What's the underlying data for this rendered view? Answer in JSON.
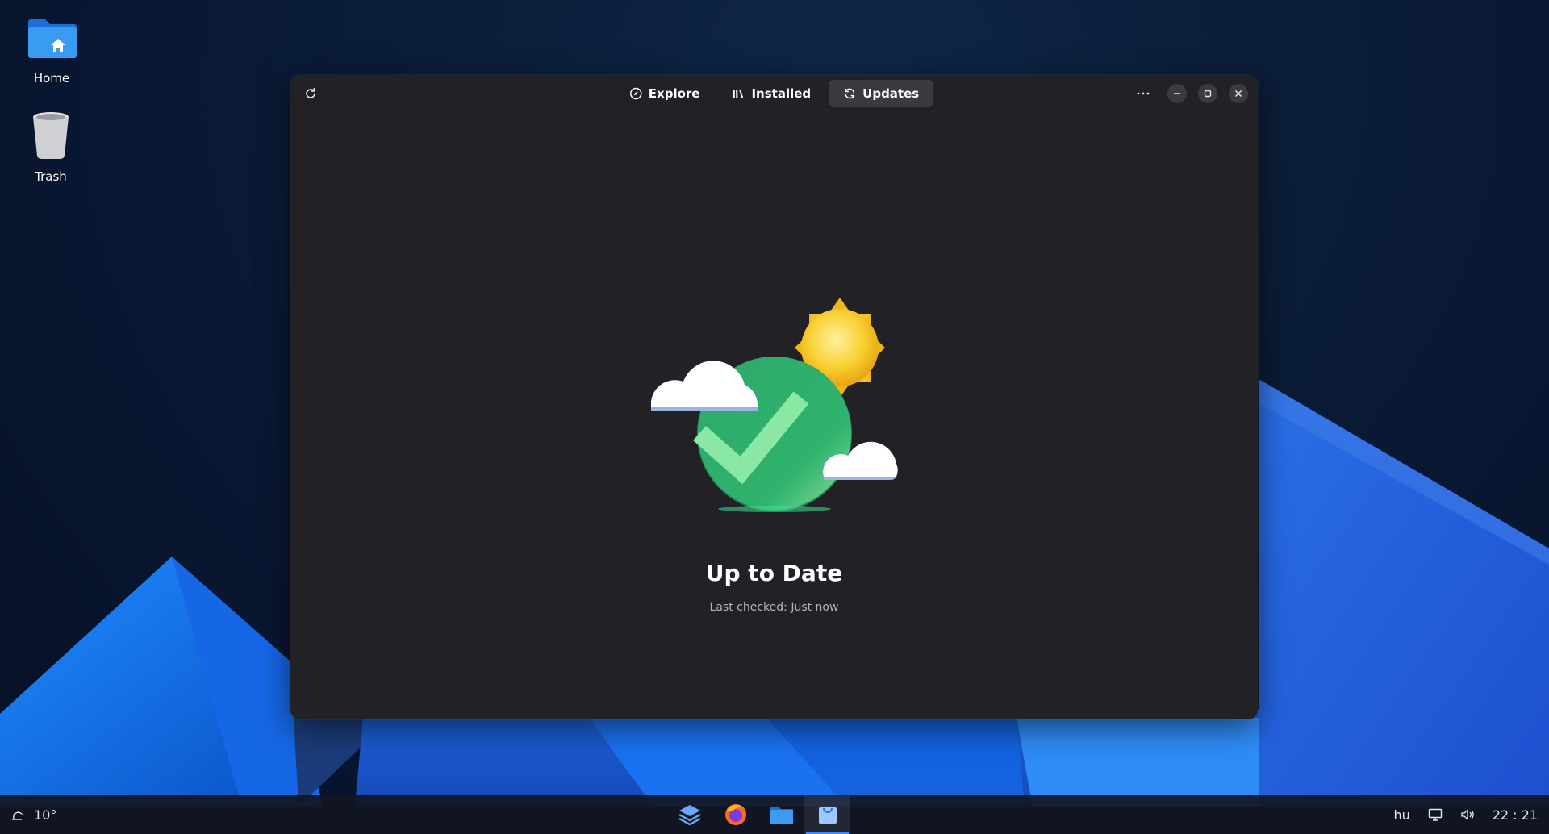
{
  "desktop": {
    "icons": [
      {
        "label": "Home",
        "icon": "home-folder-icon"
      },
      {
        "label": "Trash",
        "icon": "trash-icon"
      }
    ]
  },
  "window": {
    "tabs": [
      {
        "label": "Explore",
        "icon": "compass-icon"
      },
      {
        "label": "Installed",
        "icon": "library-icon"
      },
      {
        "label": "Updates",
        "icon": "refresh-icon",
        "active": true
      }
    ],
    "menu_label": "···",
    "status": {
      "title": "Up to Date",
      "subtitle": "Last checked: Just now"
    }
  },
  "taskbar": {
    "weather": {
      "temperature": "10°",
      "icon": "weather-icon"
    },
    "apps": [
      "layers-icon",
      "firefox-icon",
      "files-icon",
      "software-store-icon"
    ],
    "tray": {
      "keyboard_layout": "hu",
      "clock": "22 : 21"
    }
  },
  "colors": {
    "window_bg": "#222226",
    "active_tab": "#3a3a40",
    "accent": "#3d8bff",
    "check_green": "#2ea86a"
  }
}
